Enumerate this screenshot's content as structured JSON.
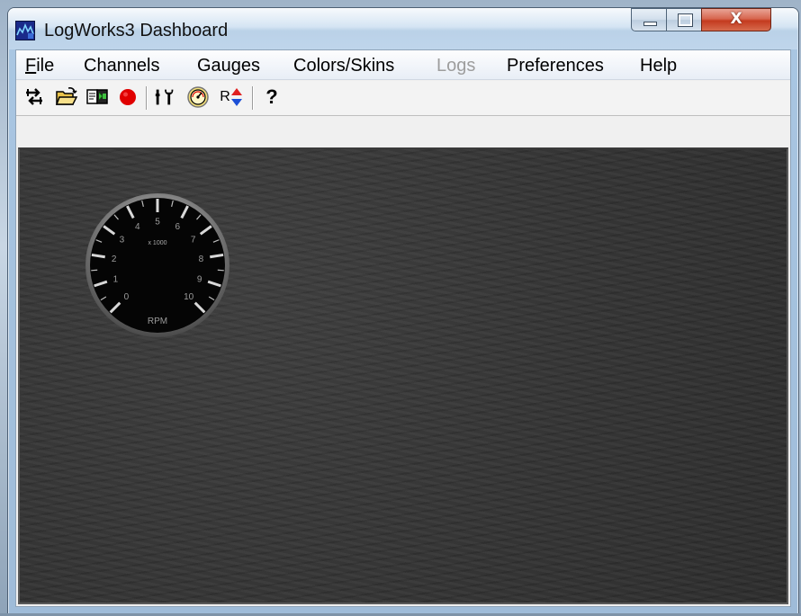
{
  "window": {
    "title": "LogWorks3 Dashboard",
    "app_icon": "logworks-chart-icon",
    "controls": {
      "minimize": "minimize-icon",
      "maximize": "maximize-icon",
      "close_glyph": "X"
    }
  },
  "menu": {
    "items": [
      {
        "label": "File",
        "mnemonic": "F",
        "rest": "ile",
        "disabled": false
      },
      {
        "label": "Channels",
        "disabled": false
      },
      {
        "label": "Gauges",
        "disabled": false
      },
      {
        "label": "Colors/Skins",
        "disabled": false
      },
      {
        "label": "Logs",
        "disabled": true
      },
      {
        "label": "Preferences",
        "disabled": false
      },
      {
        "label": "Help",
        "disabled": false
      }
    ]
  },
  "toolbar": {
    "buttons": [
      {
        "icon": "channels-arrows-icon"
      },
      {
        "icon": "open-folder-icon"
      },
      {
        "icon": "export-icon"
      },
      {
        "icon": "record-icon",
        "color": "#e00000"
      },
      {
        "icon": "tools-icon"
      },
      {
        "icon": "gauge-icon"
      },
      {
        "icon": "reset-icon",
        "label": "R"
      },
      {
        "icon": "help-icon",
        "label": "?"
      }
    ]
  },
  "gauge": {
    "type": "tachometer",
    "unit_label": "RPM",
    "multiplier_label": "x 1000",
    "scale_labels": [
      "0",
      "1",
      "2",
      "3",
      "4",
      "5",
      "6",
      "7",
      "8",
      "9",
      "10"
    ],
    "value": 0
  },
  "colors": {
    "dashboard_bg": "#333333",
    "gauge_face": "#050505",
    "record_red": "#e00000"
  }
}
